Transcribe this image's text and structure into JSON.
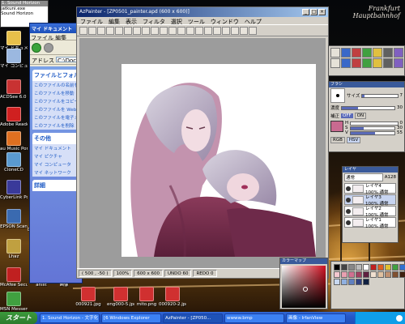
{
  "wallpaper": {
    "caption": "Frankfurt Hauptbahnhof"
  },
  "small_window": {
    "title": "1. Sound Horizon",
    "line1": "jatkuni.exe",
    "line2": "Sound Horizon"
  },
  "desktop_icons": [
    {
      "label": "マイ ドキュメント",
      "icon": "folder-icon",
      "color": "#e8c04a"
    },
    {
      "label": "マイ コンピュータ",
      "icon": "computer-icon",
      "color": "#9bb8e0"
    },
    {
      "label": "ACDSee 6.0 PENTA",
      "icon": "acdsee-icon",
      "color": "#c83232"
    },
    {
      "label": "Adobe Reader 6.0",
      "icon": "pdf-icon",
      "color": "#d02020"
    },
    {
      "label": "au Music Port",
      "icon": "music-icon",
      "color": "#e07020"
    },
    {
      "label": "CloneCD",
      "icon": "clonecd-icon",
      "color": "#5a9ad0"
    },
    {
      "label": "CyberLink PowerDVD",
      "icon": "dvd-icon",
      "color": "#3a3a9a"
    },
    {
      "label": "EPSON Scan",
      "icon": "scanner-icon",
      "color": "#3a6ab0"
    },
    {
      "label": "Lhaz",
      "icon": "archive-icon",
      "color": "#c0a040"
    },
    {
      "label": "McAfee Security",
      "icon": "mcafee-icon",
      "color": "#c02020"
    },
    {
      "label": "MSN Messenger 7.0",
      "icon": "msn-icon",
      "color": "#40a040"
    },
    {
      "label": "DataRecovery",
      "icon": "folder-icon",
      "color": "#e8c04a"
    },
    {
      "label": "新しいフォルダ",
      "icon": "folder-icon",
      "color": "#e8c04a"
    },
    {
      "label": "ahist",
      "icon": "folder-icon",
      "color": "#e8c04a"
    },
    {
      "label": "新しいフォルダ",
      "icon": "folder-icon",
      "color": "#e8c04a"
    },
    {
      "label": "ahist",
      "icon": "folder-icon",
      "color": "#e8c04a"
    },
    {
      "label": "画像",
      "icon": "folder-icon",
      "color": "#e8c04a"
    },
    {
      "label": "000921.jpg",
      "icon": "image-file-icon",
      "color": "#d03030"
    },
    {
      "label": "eng000-5.jpg",
      "icon": "image-file-icon",
      "color": "#d03030"
    },
    {
      "label": "mito.png",
      "icon": "image-file-icon",
      "color": "#d03030"
    },
    {
      "label": "000920-2.jpg",
      "icon": "image-file-icon",
      "color": "#d03030"
    }
  ],
  "explorer": {
    "title": "マイ ドキュメント",
    "menu": "ファイル 編集",
    "address_label": "アドレス",
    "address": "C:\\Documents",
    "file_tasks_title": "ファイルとフォルダのタスク",
    "file_tasks": [
      "このファイルの名前を",
      "このファイルを移動",
      "このファイルをコピー",
      "このファイルを Web に",
      "このファイルを電子メ",
      "このファイルを削除"
    ],
    "other_places_title": "その他",
    "other_places": [
      "マイ ドキュメント",
      "マイ ピクチャ",
      "マイ コンピュータ",
      "マイ ネットワーク"
    ],
    "details_title": "詳細"
  },
  "painter": {
    "title": "AzPainter - [ZP0501_painter.apd (600 x 600)]",
    "menu": [
      "ファイル",
      "編集",
      "表示",
      "フィルタ",
      "選択",
      "ツール",
      "ウィンドウ",
      "ヘルプ"
    ],
    "status": [
      "( 500 , -50 )",
      "100%",
      "600 x 600",
      "UNDO 60",
      "REDO 0"
    ]
  },
  "brush_panel": {
    "title": "ブラシ",
    "size_label": "サイズ",
    "size_value": "7",
    "density_label": "濃度",
    "density_value": "30",
    "mode_options": [
      "OFF",
      "ON"
    ],
    "smooth_label": "補正",
    "rows": [
      {
        "label": "H",
        "value": "0"
      },
      {
        "label": "S",
        "value": "30"
      },
      {
        "label": "V",
        "value": "55"
      }
    ],
    "mode_buttons": [
      "RGB",
      "HSV"
    ]
  },
  "layer_panel": {
    "title": "レイヤ",
    "blend_mode": "通常",
    "opacity": "A128",
    "layers": [
      {
        "name": "レイヤ4",
        "info": "100% 通常",
        "selected": false
      },
      {
        "name": "レイヤ3",
        "info": "100% 通常",
        "selected": true
      },
      {
        "name": "レイヤ2",
        "info": "100% 通常",
        "selected": false
      },
      {
        "name": "レイヤ1",
        "info": "100% 通常",
        "selected": false
      }
    ]
  },
  "color_panel": {
    "title": "カラーマップ"
  },
  "taskbar": {
    "start_label": "スタート",
    "tasks": [
      "1. Sound Horizon - 文字化",
      "[6 Windows Explorer",
      "AzPainter - [ZP050...",
      "wwww.bmp",
      "画像 - IrfanView"
    ],
    "active_index": 2
  }
}
